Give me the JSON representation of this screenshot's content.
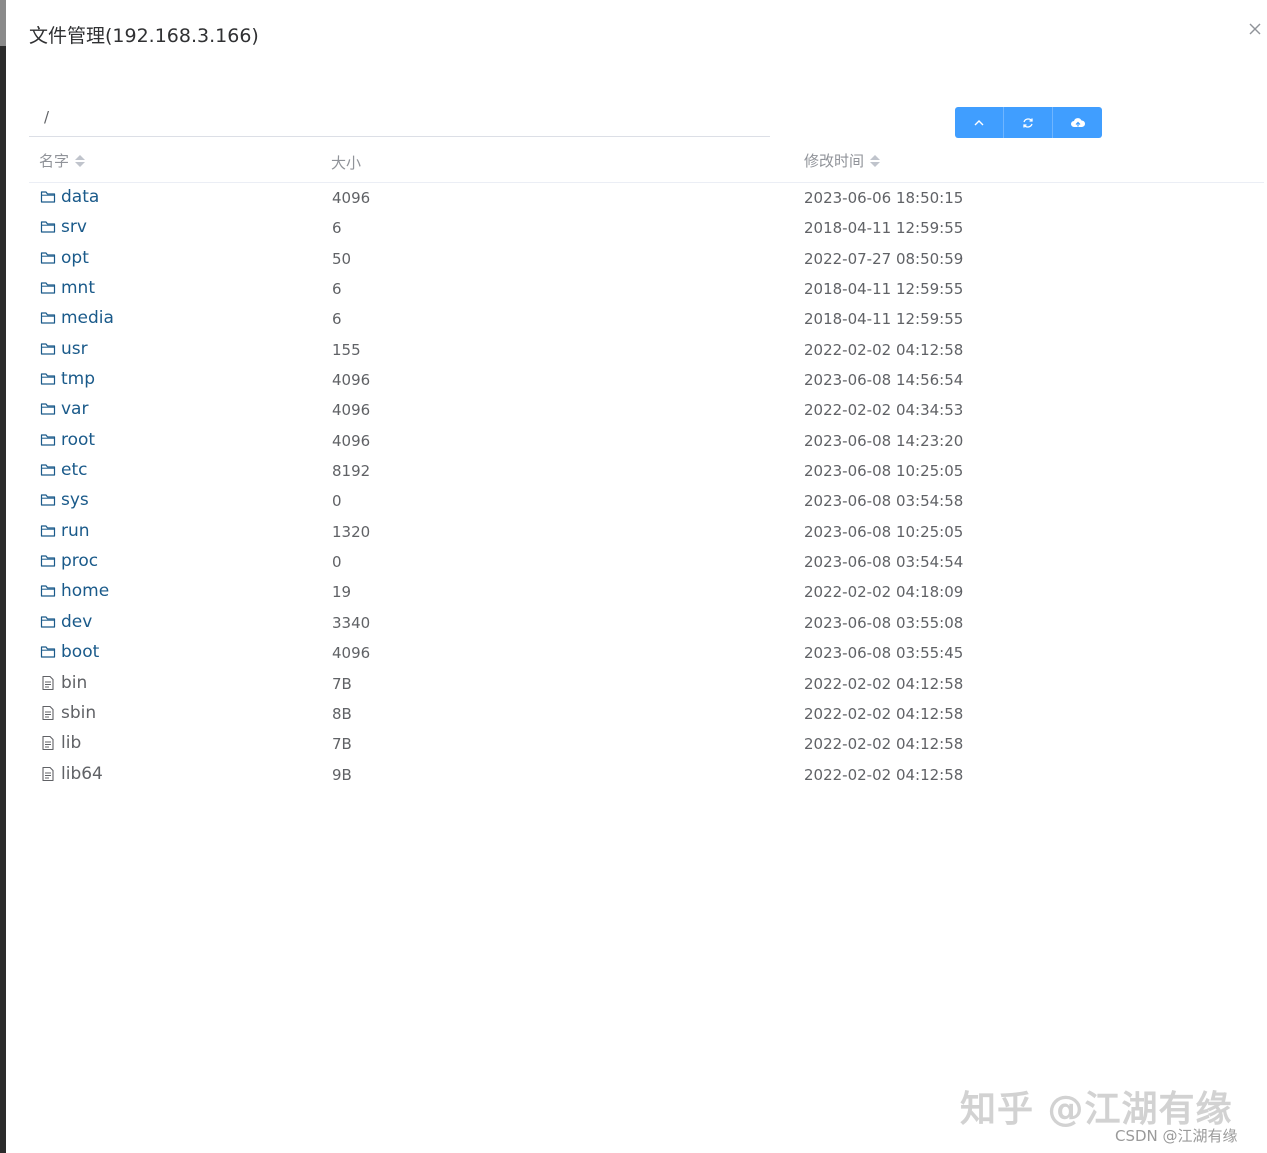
{
  "dialog": {
    "title": "文件管理(192.168.3.166)"
  },
  "path": {
    "value": "/"
  },
  "toolbar": {
    "buttons": [
      {
        "icon": "arrow-up-icon"
      },
      {
        "icon": "refresh-icon"
      },
      {
        "icon": "upload-cloud-icon"
      }
    ]
  },
  "table": {
    "columns": {
      "name": "名字",
      "size": "大小",
      "time": "修改时间"
    },
    "rows": [
      {
        "type": "dir",
        "name": "data",
        "size": "4096",
        "time": "2023-06-06 18:50:15"
      },
      {
        "type": "dir",
        "name": "srv",
        "size": "6",
        "time": "2018-04-11 12:59:55"
      },
      {
        "type": "dir",
        "name": "opt",
        "size": "50",
        "time": "2022-07-27 08:50:59"
      },
      {
        "type": "dir",
        "name": "mnt",
        "size": "6",
        "time": "2018-04-11 12:59:55"
      },
      {
        "type": "dir",
        "name": "media",
        "size": "6",
        "time": "2018-04-11 12:59:55"
      },
      {
        "type": "dir",
        "name": "usr",
        "size": "155",
        "time": "2022-02-02 04:12:58"
      },
      {
        "type": "dir",
        "name": "tmp",
        "size": "4096",
        "time": "2023-06-08 14:56:54"
      },
      {
        "type": "dir",
        "name": "var",
        "size": "4096",
        "time": "2022-02-02 04:34:53"
      },
      {
        "type": "dir",
        "name": "root",
        "size": "4096",
        "time": "2023-06-08 14:23:20"
      },
      {
        "type": "dir",
        "name": "etc",
        "size": "8192",
        "time": "2023-06-08 10:25:05"
      },
      {
        "type": "dir",
        "name": "sys",
        "size": "0",
        "time": "2023-06-08 03:54:58"
      },
      {
        "type": "dir",
        "name": "run",
        "size": "1320",
        "time": "2023-06-08 10:25:05"
      },
      {
        "type": "dir",
        "name": "proc",
        "size": "0",
        "time": "2023-06-08 03:54:54"
      },
      {
        "type": "dir",
        "name": "home",
        "size": "19",
        "time": "2022-02-02 04:18:09"
      },
      {
        "type": "dir",
        "name": "dev",
        "size": "3340",
        "time": "2023-06-08 03:55:08"
      },
      {
        "type": "dir",
        "name": "boot",
        "size": "4096",
        "time": "2023-06-08 03:55:45"
      },
      {
        "type": "file",
        "name": "bin",
        "size": "7B",
        "time": "2022-02-02 04:12:58"
      },
      {
        "type": "file",
        "name": "sbin",
        "size": "8B",
        "time": "2022-02-02 04:12:58"
      },
      {
        "type": "file",
        "name": "lib",
        "size": "7B",
        "time": "2022-02-02 04:12:58"
      },
      {
        "type": "file",
        "name": "lib64",
        "size": "9B",
        "time": "2022-02-02 04:12:58"
      }
    ]
  },
  "watermark": {
    "main": "知乎 @江湖有缘",
    "sub": "CSDN @江湖有缘"
  },
  "colors": {
    "primary": "#409eff",
    "dir_link": "#1a5a8a",
    "text": "#606266",
    "header_text": "#909399"
  }
}
